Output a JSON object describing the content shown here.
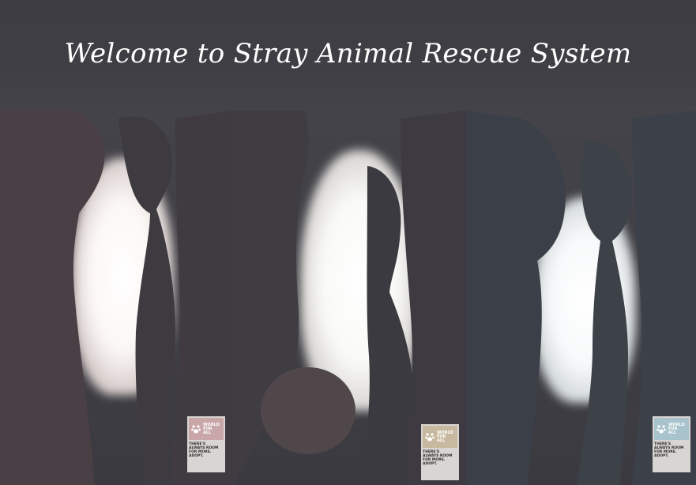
{
  "page": {
    "title": "Welcome to Stray Animal Rescue System"
  },
  "posters": [
    {
      "logo_lines": [
        "WORLD",
        "FOR",
        "ALL"
      ],
      "slogan_lines": [
        "THERE'S",
        "ALWAYS ROOM",
        "FOR MORE.",
        "ADOPT."
      ],
      "accent": "#c9a7a9"
    },
    {
      "logo_lines": [
        "WORLD",
        "FOR",
        "ALL"
      ],
      "slogan_lines": [
        "THERE'S",
        "ALWAYS ROOM",
        "FOR MORE.",
        "ADOPT."
      ],
      "accent": "#c7b9a0"
    },
    {
      "logo_lines": [
        "WORLD",
        "FOR",
        "ALL"
      ],
      "slogan_lines": [
        "THERE'S",
        "ALWAYS ROOM",
        "FOR MORE.",
        "ADOPT."
      ],
      "accent": "#a9c3cc"
    }
  ],
  "colors": {
    "background": "#3a3a40",
    "title": "#ffffff"
  }
}
